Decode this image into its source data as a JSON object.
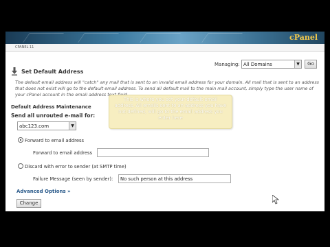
{
  "header": {
    "brand": "cPanel",
    "crumb": "CPANEL 11"
  },
  "managing": {
    "label": "Managing:",
    "selected": "All Domains",
    "go_label": "Go"
  },
  "page": {
    "title": "Set Default Address",
    "description": "The default email address will \"catch\" any mail that is sent to an invalid email address for your domain. All mail that is sent to an address that does not exist will go to the default email address. To send all default mail to the main mail account, simply type the user name of your cPanel account in the email address text field."
  },
  "maintenance": {
    "section_title": "Default Address Maintenance",
    "send_label": "Send all unrouted e-mail for:",
    "domain_selected": "abc123.com",
    "forward_option": "Forward to email address",
    "forward_field_label": "Forward to email address",
    "forward_value": "",
    "discard_option": "Discard with error to sender (at SMTP time)",
    "failure_label": "Failure Message (seen by sender):",
    "failure_value": "No such person at this address",
    "advanced_label": "Advanced Options »",
    "change_label": "Change"
  },
  "tooltip": {
    "text": "This is where you set your default email address. All emails sent to an address you have not defined, will go to the email address you enter here"
  },
  "colors": {
    "link": "#2a5a8a",
    "brand": "#f4c94a",
    "tooltip_bg": "#f7eec0"
  }
}
